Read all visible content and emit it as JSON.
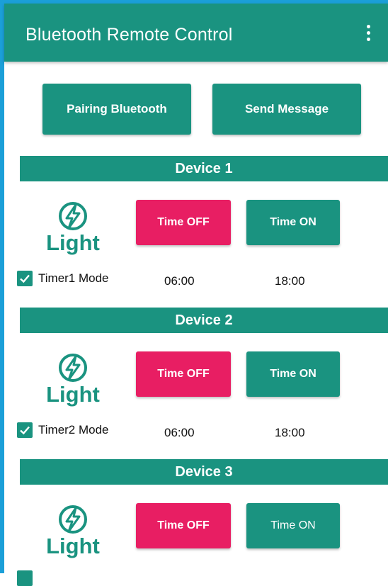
{
  "app": {
    "title": "Bluetooth Remote Control"
  },
  "icons": {
    "menu": "more-vert-icon",
    "logo": "lightning-bolt-icon",
    "checkbox": "check-icon"
  },
  "colors": {
    "primary": "#1a9380",
    "accent": "#e81e63",
    "frame": "#1b9fd8"
  },
  "actions": {
    "pairing_label": "Pairing Bluetooth",
    "send_label": "Send Message"
  },
  "devices": [
    {
      "header": "Device 1",
      "logo_text": "Light",
      "off_label": "Time OFF",
      "on_label": "Time ON",
      "mode_label": "Timer1 Mode",
      "mode_checked": true,
      "off_time": "06:00",
      "on_time": "18:00"
    },
    {
      "header": "Device 2",
      "logo_text": "Light",
      "off_label": "Time OFF",
      "on_label": "Time ON",
      "mode_label": "Timer2 Mode",
      "mode_checked": true,
      "off_time": "06:00",
      "on_time": "18:00"
    },
    {
      "header": "Device 3",
      "logo_text": "Light",
      "off_label": "Time OFF",
      "on_label": "Time ON",
      "mode_checked": true
    }
  ]
}
